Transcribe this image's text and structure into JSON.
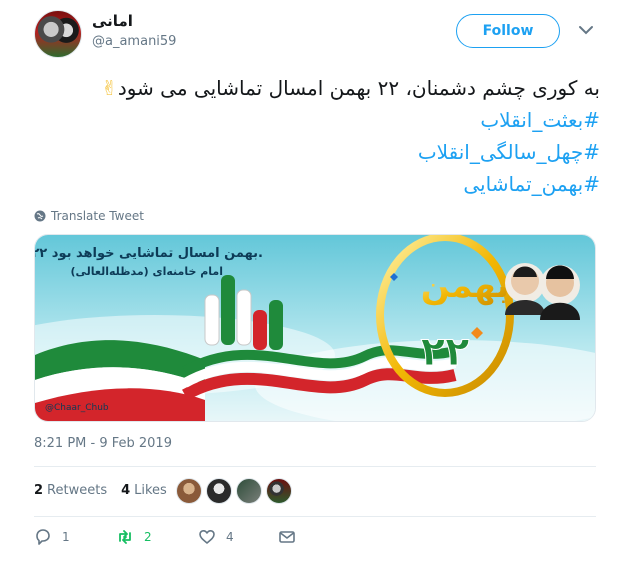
{
  "tweet": {
    "author_name": "امانی",
    "handle": "@a_amani59",
    "follow_label": "Follow",
    "text_line1": "به کوری چشم دشمنان، ۲۲ بهمن امسال تماشایی می شود",
    "emoji": "✌",
    "hashtags": [
      "#بعثت_انقلاب",
      "#چهل_سالگی_انقلاب",
      "#بهمن_تماشایی"
    ],
    "translate_label": "Translate Tweet",
    "media": {
      "headline": "۲۲ بهمن امسال تماشایی خواهد بود.",
      "attribution": "امام خامنه‌ای (مدظله‌العالی)",
      "watermark": "@Chaar_Chub",
      "bahman": "بهمن",
      "number": "۲۲"
    },
    "timestamp": "8:21 PM - 9 Feb 2019",
    "retweets_count": "2",
    "retweets_label": "Retweets",
    "likes_count": "4",
    "likes_label": "Likes",
    "replies": "1",
    "retweets_action": "2",
    "likes_action": "4"
  },
  "colors": {
    "accent": "#1da1f2",
    "retweet": "#17bf63",
    "muted": "#657786"
  },
  "icons": [
    "globe-icon",
    "chevron-down-icon",
    "reply-icon",
    "retweet-icon",
    "heart-icon",
    "message-icon"
  ]
}
